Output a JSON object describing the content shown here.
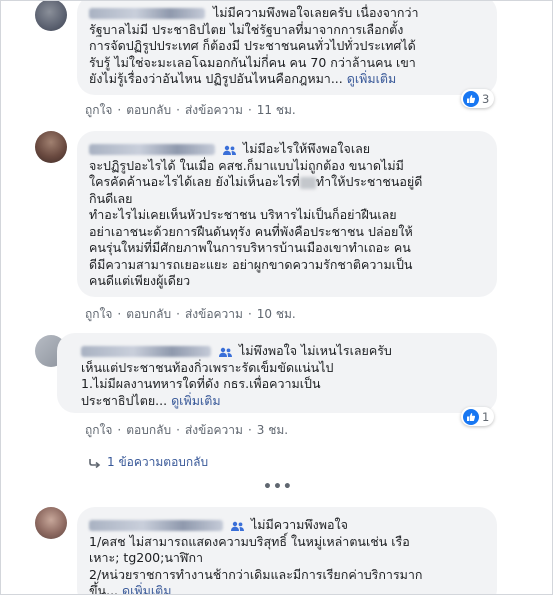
{
  "comments": [
    {
      "lines": [
        "ไม่มีความพึงพอใจเลยครับ เนื่องจากว่า",
        "รัฐบาลไม่มี ประชาธิปไตย ไม่ใช่รัฐบาลที่มาจากการเลือกตั้ง",
        "การจัดปฏิรูปประเทศ ก็ต้องมี ประชาชนคนทั่วไปทั่วประเทศได้",
        "รับรู้ ไม่ใช่จะมะเลอโฉมอกกันไม่กี่คน คน 70 กว่าล้านคน เขา",
        "ยังไม่รู้เรื่องว่าอันไหน ปฏิรูปอันไหนคือกฎหมา..."
      ],
      "see_more": "ดูเพิ่มเติม",
      "actions": {
        "like": "ถูกใจ",
        "reply": "ตอบกลับ",
        "share": "ส่งข้อความ",
        "time": "11 ชม."
      },
      "reaction_count": "3"
    },
    {
      "lines": [
        "ไม่มีอะไรให้พึงพอใจเลย",
        "จะปฏิรูปอะไรได้ ในเมื่อ คสช.ก็มาแบบไม่ถูกต้อง ขนาดไม่มี",
        "ใครคัดค้านอะไรได้เลย ยังไม่เห็นอะไรที่",
        "ทำให้ประชาชนอยู่ดี",
        "กินดีเลย",
        "ทำอะไรไม่เคยเห็นหัวประชาชน บริหารไม่เป็นก็อย่าฝืนเลย",
        "อย่าเอาชนะด้วยการฝืนดันทุรัง คนที่พังคือประชาชน ปล่อยให้",
        "คนรุ่นใหม่ที่มีศักยภาพในการบริหารบ้านเมืองเขาทำเถอะ คน",
        "ดีมีความสามารถเยอะแยะ อย่าผูกขาดความรักชาติความเป็น",
        "คนดีแต่เพียงผู้เดียว"
      ],
      "actions": {
        "like": "ถูกใจ",
        "reply": "ตอบกลับ",
        "share": "ส่งข้อความ",
        "time": "10 ชม."
      }
    },
    {
      "lines": [
        "ไม่พึงพอใจ ไม่เหนไรเลยครับ",
        "เห็นแต่ประชาชนท้องกิ่วเพราะรัดเข็มขัดแน่นไป",
        "1.ไม่มีผลงานทหารใดที่ดัง กธร.เพื่อความเป็น",
        "ประชาธิปไตย..."
      ],
      "see_more": "ดูเพิ่มเติม",
      "actions": {
        "like": "ถูกใจ",
        "reply": "ตอบกลับ",
        "share": "ส่งข้อความ",
        "time": "3 ชม."
      },
      "reaction_count": "1",
      "replies_link": "1 ข้อความตอบกลับ"
    },
    {
      "lines": [
        "ไม่มีความพึงพอใจ",
        "1/คสช ไม่สามารถแสดงความบริสุทธิ์ ในหมู่เหล่าตนเช่น เรือ",
        "เหาะ; tg200;นาฬิกา",
        "2/หน่วยราชการทำงานช้ากว่าเดิมและมีการเรียกค่าบริการมาก",
        "ขึ้น...",
        "ดูเพิ่มเติม"
      ]
    }
  ],
  "more_comments": "•••",
  "colors": {
    "link": "#385898",
    "bubble": "#f2f3f5",
    "like_blue": "#1877f2",
    "muted": "#606770"
  }
}
